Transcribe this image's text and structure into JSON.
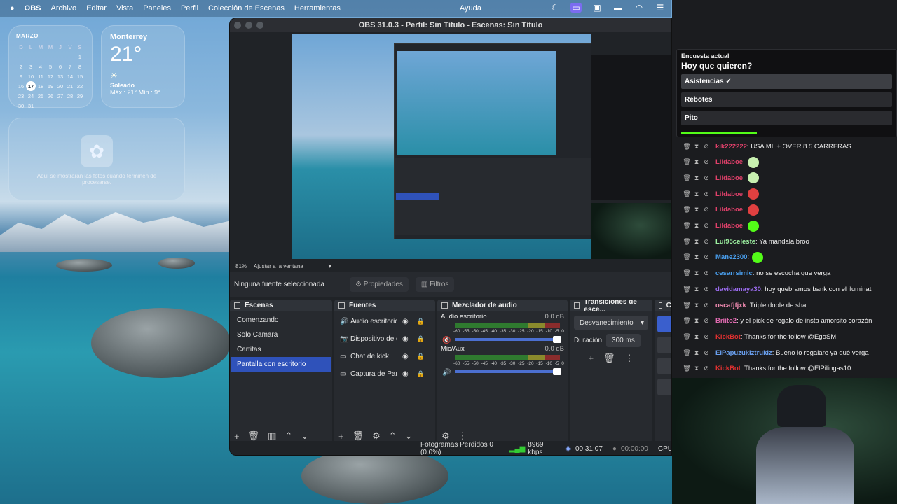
{
  "menubar": {
    "apple": "",
    "app_name": "OBS",
    "items": [
      "Archivo",
      "Editar",
      "Vista",
      "Paneles",
      "Perfil",
      "Colección de Escenas",
      "Herramientas",
      "Ayuda"
    ]
  },
  "calendar": {
    "month": "MARZO",
    "weekdays": [
      "D",
      "L",
      "M",
      "M",
      "J",
      "V",
      "S"
    ],
    "weeks": [
      [
        "",
        "",
        "",
        "",
        "",
        "",
        "1"
      ],
      [
        "2",
        "3",
        "4",
        "5",
        "6",
        "7",
        "8"
      ],
      [
        "9",
        "10",
        "11",
        "12",
        "13",
        "14",
        "15"
      ],
      [
        "16",
        "17",
        "18",
        "19",
        "20",
        "21",
        "22"
      ],
      [
        "23",
        "24",
        "25",
        "26",
        "27",
        "28",
        "29"
      ],
      [
        "30",
        "31",
        "",
        "",
        "",
        "",
        ""
      ]
    ],
    "today": "17"
  },
  "weather": {
    "city": "Monterrey",
    "temp": "21°",
    "condition": "Soleado",
    "hilo": "Máx.: 21° Mín.: 9°"
  },
  "photos": {
    "text": "Aquí se mostrarán las fotos cuando terminen de procesarse."
  },
  "obs": {
    "title": "OBS 31.0.3 - Perfil: Sin Título - Escenas: Sin Título",
    "zoom": "81%",
    "fit": "Ajustar a la ventana",
    "no_source": "Ninguna fuente seleccionada",
    "properties_btn": "Propiedades",
    "filters_btn": "Filtros",
    "scenes_title": "Escenas",
    "scenes": [
      "Comenzando",
      "Solo Camara",
      "Cartitas",
      "Pantalla con escritorio"
    ],
    "selected_scene": 3,
    "sources_title": "Fuentes",
    "sources": [
      {
        "icon": "🔊",
        "label": "Audio escritorio"
      },
      {
        "icon": "📷",
        "label": "Dispositivo de c"
      },
      {
        "icon": "▭",
        "label": "Chat de kick"
      },
      {
        "icon": "▭",
        "label": "Captura de Pan"
      }
    ],
    "mixer_title": "Mezclador de audio",
    "mixer": [
      {
        "name": "Audio escritorio",
        "db": "0.0 dB",
        "muted": true
      },
      {
        "name": "Mic/Aux",
        "db": "0.0 dB",
        "muted": false
      }
    ],
    "ticks": [
      "-60",
      "-55",
      "-50",
      "-45",
      "-40",
      "-35",
      "-30",
      "-25",
      "-20",
      "-15",
      "-10",
      "-5",
      "0"
    ],
    "transitions_title": "Transiciones de esce...",
    "transition": "Desvanecimiento",
    "duration_label": "Duración",
    "duration": "300 ms",
    "controls_title": "Co",
    "status": {
      "dropped": "Fotogramas Perdidos 0 (0.0%)",
      "bitrate": "8969 kbps",
      "live": "00:31:07",
      "rec": "00:00:00",
      "cpu": "CPU"
    }
  },
  "poll": {
    "title": "Encuesta actual",
    "question": "Hoy que quieren?",
    "options": [
      "Asistencias",
      "Rebotes",
      "Pito"
    ],
    "winner": 0,
    "progress": 0.9
  },
  "chat": [
    {
      "user": "kik222222",
      "color": "#e0406a",
      "text": ": USA ML + OVER 8.5 CARRERAS",
      "emote": ""
    },
    {
      "user": "Lildaboe",
      "color": "#e0406a",
      "text": ":",
      "emote": "#c8f0b0"
    },
    {
      "user": "Lildaboe",
      "color": "#e0406a",
      "text": ":",
      "emote": "#c8f0b0"
    },
    {
      "user": "Lildaboe",
      "color": "#e0406a",
      "text": ":",
      "emote": "#e04040"
    },
    {
      "user": "Lildaboe",
      "color": "#e0406a",
      "text": ":",
      "emote": "#e04040"
    },
    {
      "user": "Lildaboe",
      "color": "#e0406a",
      "text": ":",
      "emote": "#53fc18"
    },
    {
      "user": "Lui95celeste",
      "color": "#9cf0a0",
      "text": ": Ya mandala broo",
      "emote": ""
    },
    {
      "user": "Mane2300",
      "color": "#4aa0f0",
      "text": ":",
      "emote": "#53fc18"
    },
    {
      "user": "cesarrsimic",
      "color": "#4aa0f0",
      "text": ": no se escucha que verga",
      "emote": ""
    },
    {
      "user": "davidamaya30",
      "color": "#9c6cf0",
      "text": ": hoy quebramos bank con el iluminati",
      "emote": ""
    },
    {
      "user": "oscafjfjxk",
      "color": "#f08ab0",
      "text": ": Triple doble de shai",
      "emote": ""
    },
    {
      "user": "Briito2",
      "color": "#e06ab0",
      "text": ": y el pick de regalo de insta amorsito corazón",
      "emote": ""
    },
    {
      "user": "KickBot",
      "color": "#e03030",
      "text": ": Thanks for the follow @EgoSM",
      "emote": ""
    },
    {
      "user": "ElPapuzukiztrukiz",
      "color": "#6aa0f0",
      "text": ": Bueno lo regalare ya qué verga",
      "emote": ""
    },
    {
      "user": "KickBot",
      "color": "#e03030",
      "text": ": Thanks for the follow @ElPilingas10",
      "emote": ""
    }
  ]
}
